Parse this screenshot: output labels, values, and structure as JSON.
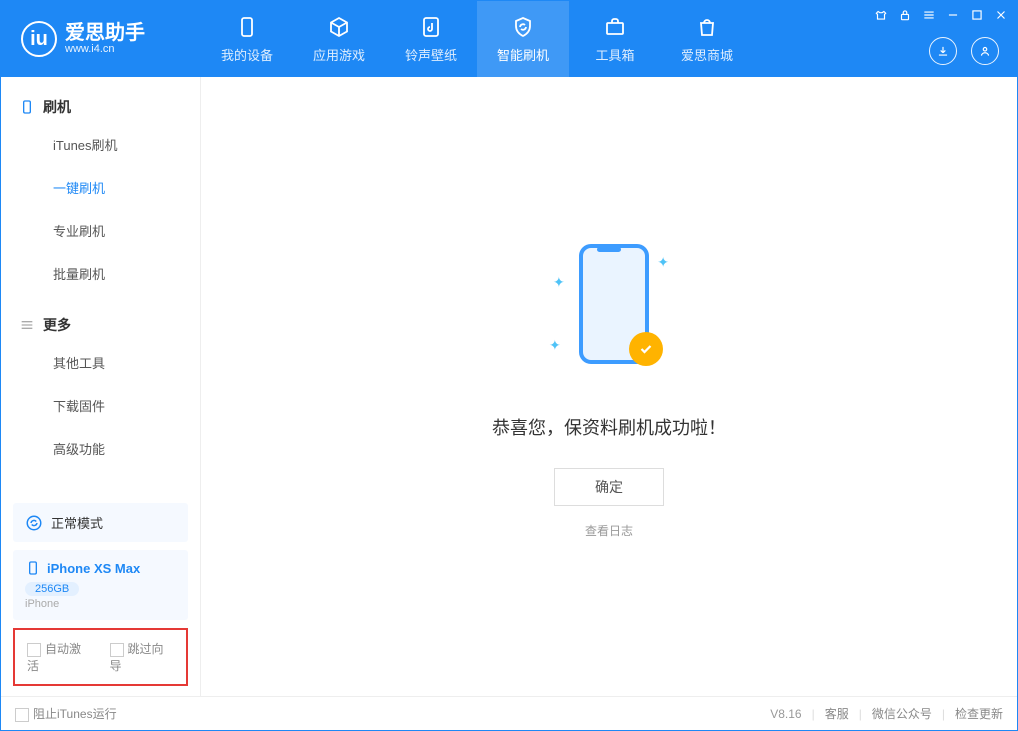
{
  "app": {
    "name": "爱思助手",
    "url": "www.i4.cn"
  },
  "nav": [
    {
      "label": "我的设备"
    },
    {
      "label": "应用游戏"
    },
    {
      "label": "铃声壁纸"
    },
    {
      "label": "智能刷机"
    },
    {
      "label": "工具箱"
    },
    {
      "label": "爱思商城"
    }
  ],
  "sidebar": {
    "section1_title": "刷机",
    "items1": [
      "iTunes刷机",
      "一键刷机",
      "专业刷机",
      "批量刷机"
    ],
    "section2_title": "更多",
    "items2": [
      "其他工具",
      "下载固件",
      "高级功能"
    ]
  },
  "device": {
    "mode": "正常模式",
    "name": "iPhone XS Max",
    "storage": "256GB",
    "type": "iPhone"
  },
  "options": {
    "auto_activate": "自动激活",
    "skip_guide": "跳过向导"
  },
  "main": {
    "success": "恭喜您，保资料刷机成功啦！",
    "ok": "确定",
    "view_log": "查看日志"
  },
  "status": {
    "block_itunes": "阻止iTunes运行",
    "version": "V8.16",
    "links": [
      "客服",
      "微信公众号",
      "检查更新"
    ]
  }
}
